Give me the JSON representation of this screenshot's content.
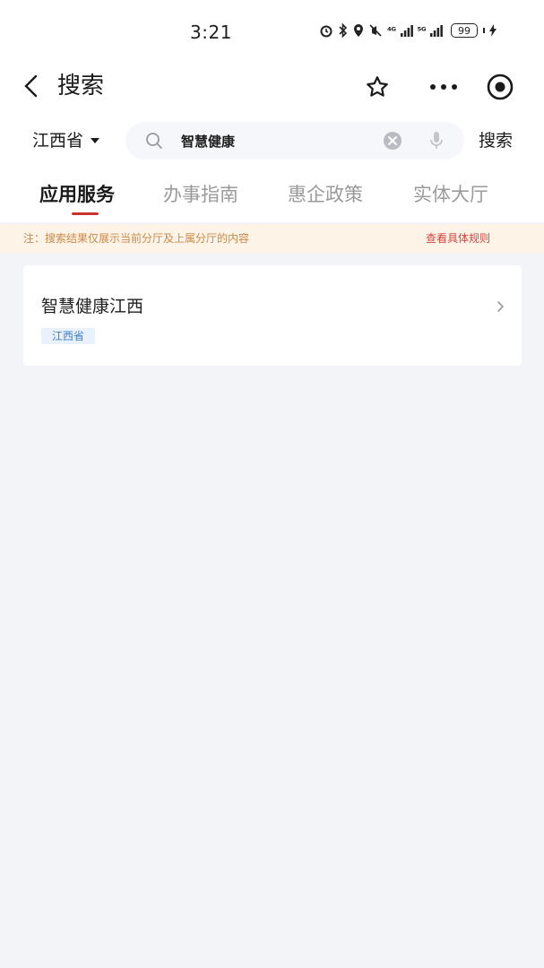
{
  "status_bar": {
    "time": "3:21",
    "signal_1": "⁴ᴳ",
    "signal_2": "⁵ᴳ",
    "battery": "99"
  },
  "nav": {
    "title": "搜索"
  },
  "search": {
    "region": "江西省",
    "query": "智慧健康",
    "button_label": "搜索"
  },
  "tabs": [
    {
      "label": "应用服务",
      "active": true
    },
    {
      "label": "办事指南",
      "active": false
    },
    {
      "label": "惠企政策",
      "active": false
    },
    {
      "label": "实体大厅",
      "active": false
    }
  ],
  "notice": {
    "text": "注：搜索结果仅展示当前分厅及上属分厅的内容",
    "link": "查看具体规则"
  },
  "results": [
    {
      "title": "智慧健康江西",
      "tag": "江西省"
    }
  ],
  "colors": {
    "accent": "#c8342e",
    "notice_bg": "#fdf3e7",
    "notice_text": "#c98a4a",
    "tag_bg": "#e8f1fc",
    "tag_text": "#3f7fd0",
    "page_bg": "#f3f4f8"
  }
}
